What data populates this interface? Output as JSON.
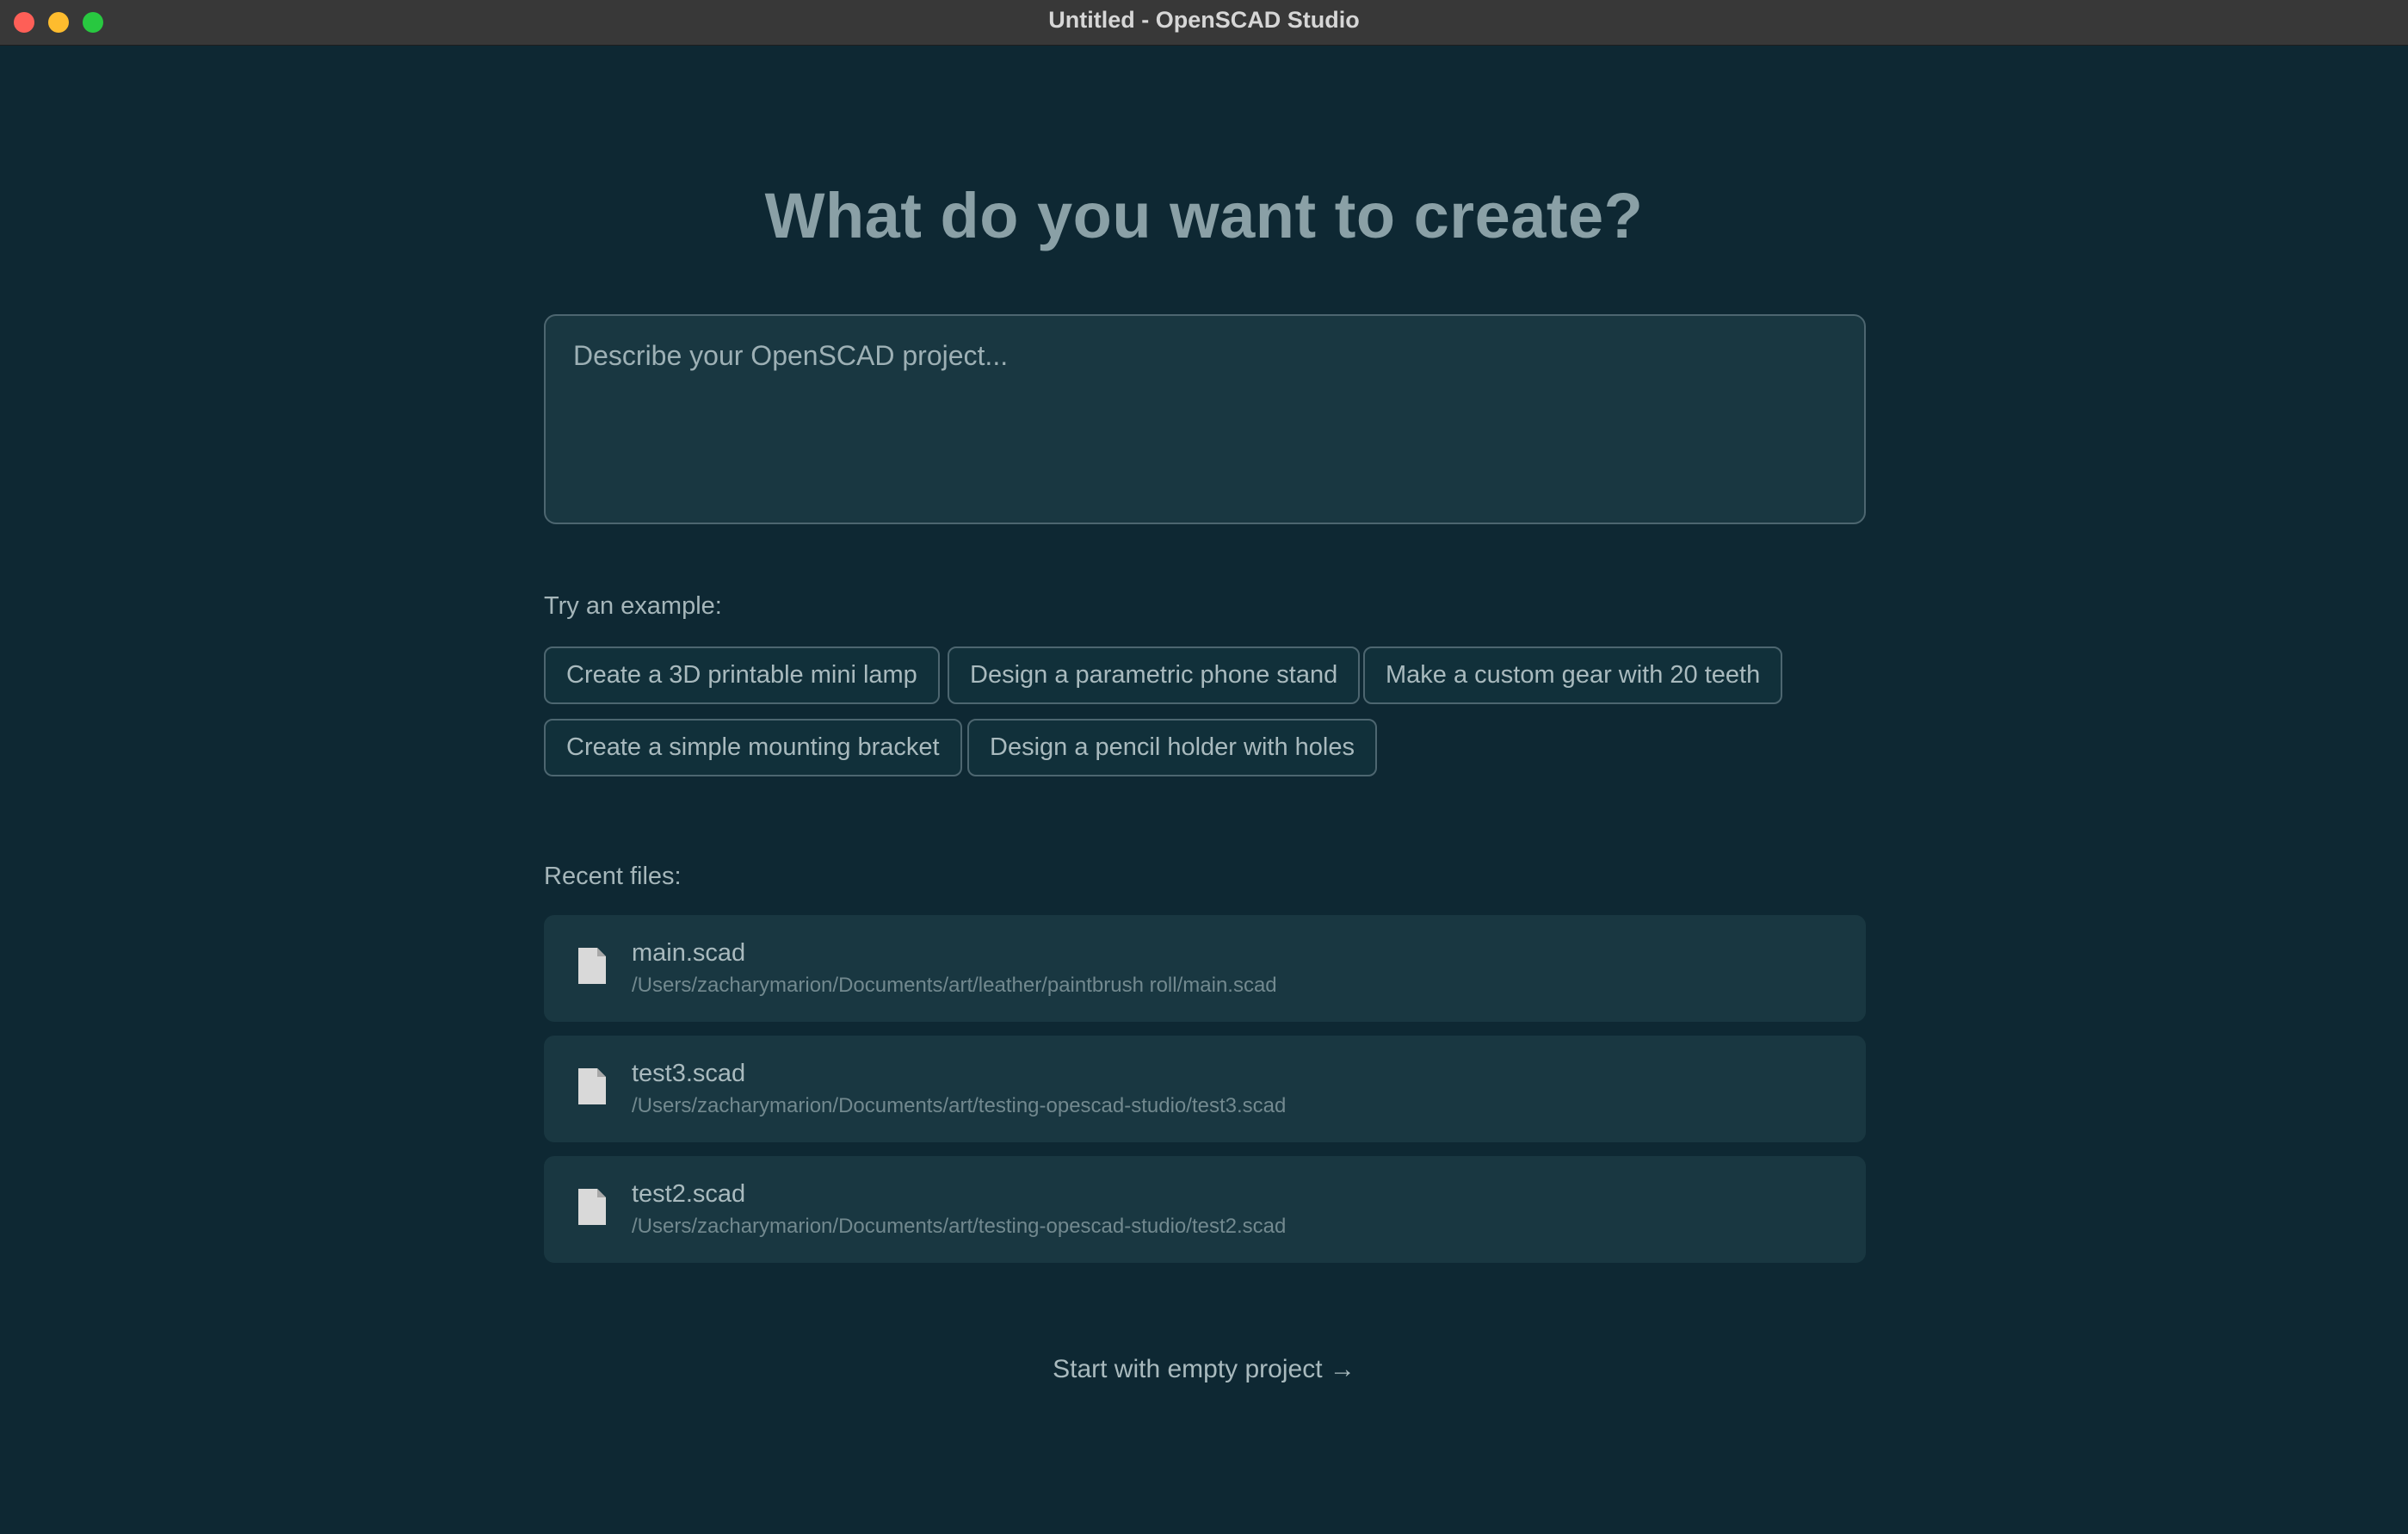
{
  "window": {
    "title": "Untitled - OpenSCAD Studio"
  },
  "main": {
    "headline": "What do you want to create?",
    "prompt_placeholder": "Describe your OpenSCAD project...",
    "examples_label": "Try an example:",
    "examples": [
      "Create a 3D printable mini lamp",
      "Design a parametric phone stand",
      "Make a custom gear with 20 teeth",
      "Create a simple mounting bracket",
      "Design a pencil holder with holes"
    ],
    "recent_label": "Recent files:",
    "recent_files": [
      {
        "name": "main.scad",
        "path": "/Users/zacharymarion/Documents/art/leather/paintbrush roll/main.scad"
      },
      {
        "name": "test3.scad",
        "path": "/Users/zacharymarion/Documents/art/testing-opescad-studio/test3.scad"
      },
      {
        "name": "test2.scad",
        "path": "/Users/zacharymarion/Documents/art/testing-opescad-studio/test2.scad"
      }
    ],
    "start_empty": "Start with empty project →"
  },
  "colors": {
    "background": "#0e2833",
    "card": "#193741",
    "border": "#4d6670",
    "text": "#a9babe"
  }
}
